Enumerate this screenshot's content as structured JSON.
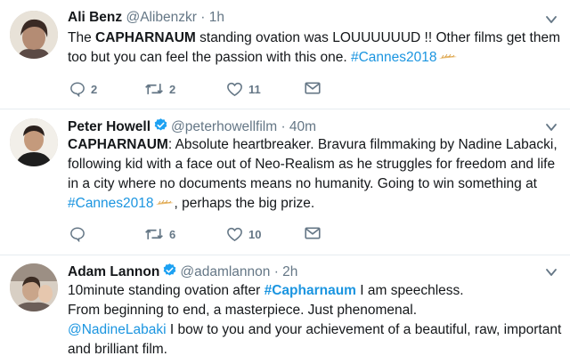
{
  "tweets": [
    {
      "name": "Ali Benz",
      "handle": "@Alibenzkr",
      "time": "· 1h",
      "lines": [
        {
          "parts": [
            {
              "t": "The "
            },
            {
              "t": "CAPHARNAUM",
              "b": true
            },
            {
              "t": " standing ovation was LOUUUUUUD !! Other films get them"
            }
          ]
        },
        {
          "parts": [
            {
              "t": "too but you can feel the passion with this one. "
            },
            {
              "t": "#Cannes2018",
              "link": true
            },
            {
              "emoji": true
            }
          ]
        }
      ],
      "actions": {
        "reply": "2",
        "retweet": "2",
        "like": "11"
      }
    },
    {
      "name": "Peter Howell",
      "handle": "@peterhowellfilm",
      "time": "· 40m",
      "verified": true,
      "lines": [
        {
          "parts": [
            {
              "t": "CAPHARNAUM",
              "b": true
            },
            {
              "t": ": Absolute heartbreaker. Bravura filmmaking by Nadine Labacki,"
            }
          ]
        },
        {
          "parts": [
            {
              "t": "following kid with a face out of Neo-Realism as he struggles for freedom and life"
            }
          ]
        },
        {
          "parts": [
            {
              "t": "in a city where no documents means no humanity. Going to win something at"
            }
          ]
        },
        {
          "parts": [
            {
              "t": "#Cannes2018",
              "link": true
            },
            {
              "emoji": true
            },
            {
              "t": ", perhaps the big prize."
            }
          ]
        }
      ],
      "actions": {
        "reply": "",
        "retweet": "6",
        "like": "10"
      }
    },
    {
      "name": "Adam Lannon",
      "handle": "@adamlannon",
      "time": "· 2h",
      "verified": true,
      "lines": [
        {
          "parts": [
            {
              "t": "10minute standing ovation after "
            },
            {
              "t": "#Capharnaum",
              "tag": true
            },
            {
              "t": " I am speechless."
            }
          ]
        },
        {
          "parts": [
            {
              "t": "From beginning to end, a masterpiece. Just phenomenal."
            }
          ]
        },
        {
          "parts": [
            {
              "t": "@NadineLabaki",
              "link": true
            },
            {
              "t": " I bow to you and your achievement of a beautiful, raw, important"
            }
          ]
        },
        {
          "parts": [
            {
              "t": "and brilliant film."
            }
          ]
        }
      ]
    }
  ],
  "icons": {
    "reply": "reply-icon",
    "retweet": "retweet-icon",
    "like": "heart-icon",
    "dm": "mail-icon",
    "caret": "chevron-down-icon",
    "verified": "verified-badge-icon",
    "emoji": "palm-leaf-emoji-icon"
  },
  "colors": {
    "link": "#1b95e0",
    "meta": "#657786",
    "text": "#14171a",
    "verified": "#1da1f2",
    "divider": "#e6ecf0"
  }
}
